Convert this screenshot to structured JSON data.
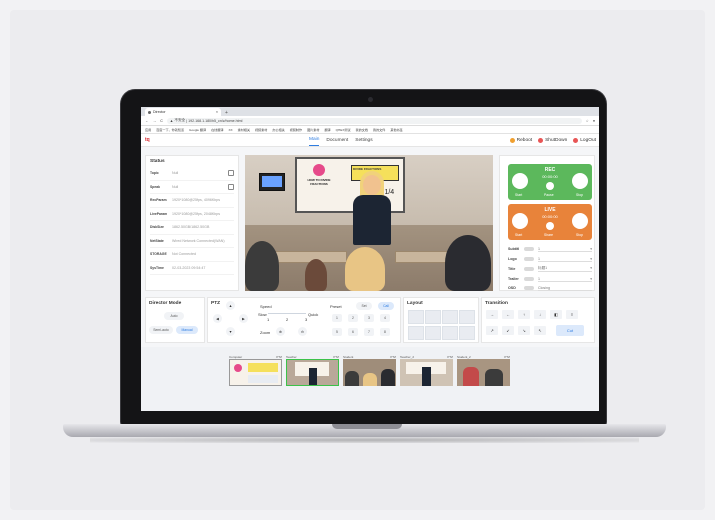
{
  "browser": {
    "tab_title": "Director",
    "url_prefix": "不安全",
    "url": "192.168.1.180/h5_cn/z/home.html",
    "bookmarks": [
      "应用",
      "百度一下，你就知道",
      "Google 翻译",
      "在线翻译",
      "XX",
      "素材相关",
      "视频素材",
      "办公相关",
      "视频制作",
      "图片素材",
      "翻译",
      "QHEX测试",
      "我的文档",
      "我的文件",
      "其他书签"
    ]
  },
  "app": {
    "logo": "tq",
    "nav": [
      "Main",
      "Document",
      "Settings"
    ],
    "actions": [
      {
        "label": "Reboot",
        "color": "#f0a030"
      },
      {
        "label": "ShutDown",
        "color": "#e85555"
      },
      {
        "label": "LogOut",
        "color": "#e85555"
      }
    ]
  },
  "status": {
    "title": "Status",
    "rows": [
      {
        "label": "Topic",
        "value": "Null"
      },
      {
        "label": "Speak",
        "value": "Null"
      },
      {
        "label": "RecParam",
        "value": "1920*1080@25fps, 4096Kbps"
      },
      {
        "label": "LiveParam",
        "value": "1920*1080@25fps, 2048Kbps"
      },
      {
        "label": "DiskSize",
        "value": "1862.50GB/1862.50GB"
      },
      {
        "label": "NetState",
        "value": "Wired Network Connected(WAN)"
      },
      {
        "label": "STORAGE",
        "value": "Not Connected"
      },
      {
        "label": "SysTime",
        "value": "02-03-2023 09:54:47"
      }
    ]
  },
  "video": {
    "board_title": "HOW TO DIVIDE FRACTIONS",
    "board_card": "DIVIDE FRACTIONS",
    "board_formula": "2/3 ÷ 1/4"
  },
  "rec": {
    "title": "REC",
    "time": "00:00:00",
    "start": "Start",
    "pause": "Pause",
    "stop": "Stop",
    "color": "#5cb85c"
  },
  "live": {
    "title": "LIVE",
    "time": "00:00:00",
    "start": "Start",
    "share": "Share",
    "stop": "Stop",
    "color": "#e8833a"
  },
  "options": [
    {
      "label": "Subtitl",
      "value": "1"
    },
    {
      "label": "Logo",
      "value": "1"
    },
    {
      "label": "Title",
      "value": "标题1"
    },
    {
      "label": "Trailer",
      "value": "1"
    },
    {
      "label": "OSD",
      "value": "Closing"
    }
  ],
  "director": {
    "title": "Director Mode",
    "auto": "Auto",
    "semi": "Semi-auto",
    "manual": "Manual"
  },
  "ptz": {
    "title": "PTZ",
    "speed": "Speed",
    "slow": "Slow",
    "quick": "Quick",
    "scale": [
      "1",
      "2",
      "3"
    ],
    "zoom": "Zoom",
    "preset": "Preset",
    "set": "Set",
    "call": "Call",
    "presets": [
      "1",
      "2",
      "3",
      "4",
      "5",
      "6",
      "7",
      "8"
    ]
  },
  "layout": {
    "title": "Layout"
  },
  "transition": {
    "title": "Transition",
    "cut": "Cut"
  },
  "sources": [
    {
      "name": "Computer",
      "tag": "PTZ"
    },
    {
      "name": "Teacher",
      "tag": "PTZ"
    },
    {
      "name": "Student",
      "tag": "PTZ"
    },
    {
      "name": "Teacher_2",
      "tag": "PTZ"
    },
    {
      "name": "Student_2",
      "tag": "PTZ"
    }
  ]
}
